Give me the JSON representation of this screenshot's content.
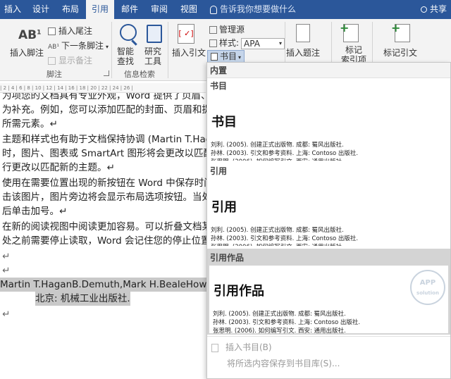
{
  "tabs": [
    "插入",
    "设计",
    "布局",
    "引用",
    "邮件",
    "审阅",
    "视图"
  ],
  "tell_me": "告诉我你想要做什么",
  "share": "共享",
  "ribbon": {
    "insert_footnote": "插入脚注",
    "insert_endnote": "插入尾注",
    "next_footnote": "下一条脚注",
    "show_notes": "显示备注",
    "footnote_group": "脚注",
    "smart_lookup_1": "智能",
    "smart_lookup_2": "查找",
    "researcher_1": "研究",
    "researcher_2": "工具",
    "info_group": "信息检索",
    "insert_citation": "插入引文",
    "manage_sources": "管理源",
    "style_label": "样式:",
    "style_value": "APA",
    "bibliography": "书目",
    "insert_caption": "插入题注",
    "mark_entry_1": "标记",
    "mark_entry_2": "索引项",
    "mark_citation": "标记引文"
  },
  "ruler": "|  2 |  4 |  6 |  8 | 10 | 12 | 14 | 16 | 18 | 20 | 22 | 24 | 26 |",
  "document": {
    "lines": [
      "为补充。例如，您可以添加匹配的封面、页眉和提",
      "所需元素。↵",
      "主题和样式也有助于文档保持协调 (Martin T.Haga",
      "时，图片、图表或 SmartArt 图形将会更改以匹配",
      "行更改以匹配新的主题。↵",
      "使用在需要位置出现的新按钮在 Word 中保存时间",
      "击该图片，图片旁边将会显示布局选项按钮。当处",
      "后单击加号。↵",
      "在新的阅读视图中阅读更加容易。可以折叠文档某",
      "处之前需要停止读取，Word 会记住您的停止位置",
      "↵",
      "↵",
      "Martin T.HaganB.Demuth,Mark H.BealeHoward. (20",
      "北京: 机械工业出版社.",
      "↵"
    ],
    "partial_top": "为项您的文档具有专业外观，Word 提供了页眉、"
  },
  "dropdown": {
    "builtin": "内置",
    "sections": [
      {
        "header": "书目",
        "title": "书目"
      },
      {
        "header": "引用",
        "title": "引用"
      },
      {
        "header": "引用作品",
        "title": "引用作品"
      }
    ],
    "entries": [
      "刘利. (2005). 创建正式出版物. 成都: 蜀风出版社.",
      "孙林. (2003). 引文和参考资料. 上海: Contoso 出版社.",
      "张思明. (2006). 如何编写引文. 西安: 通用出版社."
    ],
    "insert_bibliography": "插入书目(B)",
    "save_selection": "将所选内容保存到书目库(S)..."
  },
  "watermark": "APP solution",
  "colors": {
    "accent": "#2b579a",
    "ribbon_bg": "#f3f3f3",
    "selection": "#c9c9c9"
  }
}
